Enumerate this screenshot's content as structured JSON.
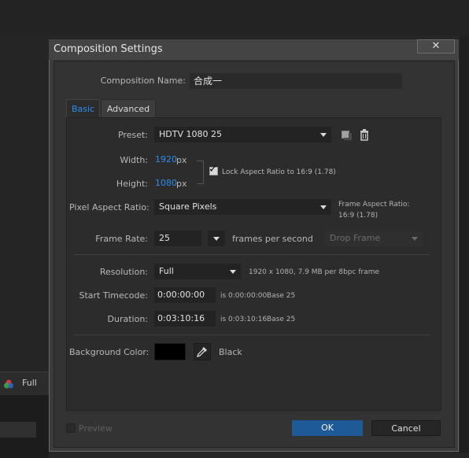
{
  "background_app": {
    "resolution_label": "Full"
  },
  "dialog": {
    "title": "Composition Settings",
    "close_glyph": "✕",
    "composition_name_label": "Composition Name:",
    "composition_name_value": "合成一",
    "tabs": [
      {
        "label": "Basic",
        "active": true
      },
      {
        "label": "Advanced",
        "active": false
      }
    ],
    "preset": {
      "label": "Preset:",
      "value": "HDTV 1080 25",
      "save_icon": "save-preset-icon",
      "delete_icon": "trash-icon"
    },
    "width": {
      "label": "Width:",
      "value": "1920",
      "unit": "px"
    },
    "height": {
      "label": "Height:",
      "value": "1080",
      "unit": "px"
    },
    "lock_aspect": {
      "checked": true,
      "label": "Lock Aspect Ratio to 16:9 (1.78)"
    },
    "pixel_aspect": {
      "label": "Pixel Aspect Ratio:",
      "value": "Square Pixels",
      "frame_aspect_label": "Frame Aspect Ratio:",
      "frame_aspect_value": "16:9 (1.78)"
    },
    "frame_rate": {
      "label": "Frame Rate:",
      "value": "25",
      "unit": "frames per second",
      "drop_frame": "Drop Frame"
    },
    "resolution": {
      "label": "Resolution:",
      "value": "Full",
      "info": "1920 x 1080, 7.9 MB per 8bpc frame"
    },
    "start_timecode": {
      "label": "Start Timecode:",
      "value": "0:00:00:00",
      "is_text": "is 0:00:00:00",
      "base": "Base 25"
    },
    "duration": {
      "label": "Duration:",
      "value": "0:03:10:16",
      "is_text": "is 0:03:10:16",
      "base": "Base 25"
    },
    "background_color": {
      "label": "Background Color:",
      "color": "#000000",
      "name": "Black"
    },
    "preview_label": "Preview",
    "ok_label": "OK",
    "cancel_label": "Cancel"
  },
  "colors": {
    "accent": "#2d8ceb",
    "ok_button": "#1d5a97"
  }
}
